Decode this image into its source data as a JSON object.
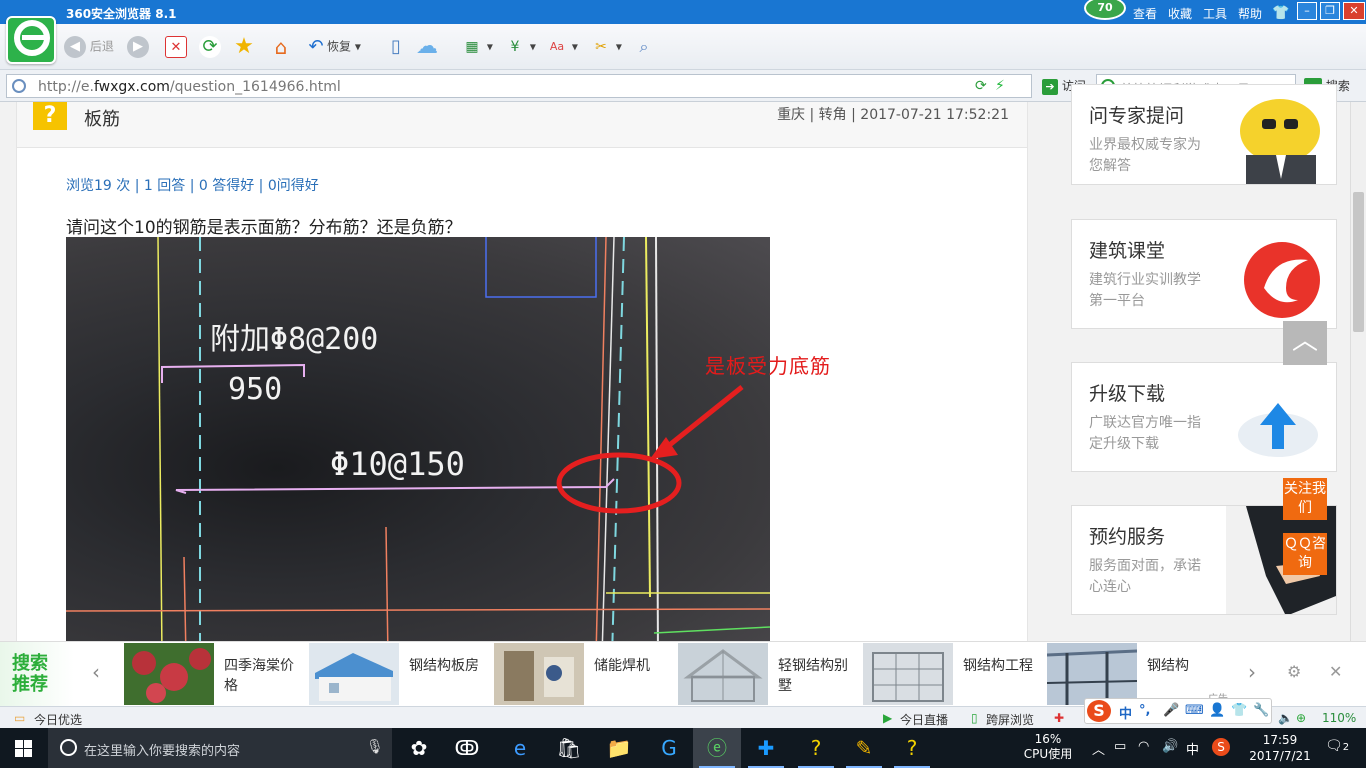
{
  "browser": {
    "title": "360安全浏览器 8.1",
    "score": "70",
    "menus": [
      "查看",
      "收藏",
      "工具",
      "帮助"
    ],
    "toolbar": {
      "back": "后退",
      "restore": "恢复"
    },
    "url_prefix": "http://e.",
    "url_domain": "fwxgx.com",
    "url_path": "/question_1614966.html",
    "visit_label": "访问",
    "search_placeholder": "羞答答福利游戏内可见",
    "search_label": "搜索"
  },
  "question": {
    "title": "板筋",
    "meta": "重庆 | 转角 | 2017-07-21 17:52:21",
    "stats": "浏览19 次 | 1 回答 | 0 答得好 | 0问得好",
    "text": "请问这个10的钢筋是表示面筋？分布筋？还是负筋？",
    "annotation": "是板受力底筋",
    "photo_labels": [
      "附加Φ8@200",
      "950",
      "Φ10@150"
    ]
  },
  "sidebar": [
    {
      "title": "问专家提问",
      "desc": "业界最权威专家为您解答"
    },
    {
      "title": "建筑课堂",
      "desc": "建筑行业实训教学第一平台"
    },
    {
      "title": "升级下载",
      "desc": "广联达官方唯一指定升级下载"
    },
    {
      "title": "预约服务",
      "desc": "服务面对面，承诺心连心"
    }
  ],
  "float": {
    "back_to_top": "︿",
    "follow": "关注我们",
    "qq": "ＱＱ咨询"
  },
  "recommend": {
    "label": "搜索推荐",
    "items": [
      {
        "text": "四季海棠价格",
        "color": "#b8323a"
      },
      {
        "text": "钢结构板房",
        "color": "#4b8fcf"
      },
      {
        "text": "储能焊机",
        "color": "#8a7a60"
      },
      {
        "text": "轻钢结构别墅",
        "color": "#9aa1a6"
      },
      {
        "text": "钢结构工程",
        "color": "#7d858c"
      },
      {
        "text": "钢结构",
        "color": "#5a6e86"
      }
    ],
    "ad_tag": "广告"
  },
  "statusbar": {
    "today": "今日优选",
    "live": "今日直播",
    "cross": "跨屏浏览",
    "zoom": "110%"
  },
  "ime": {
    "mode": "中"
  },
  "taskbar": {
    "search_placeholder": "在这里输入你要搜索的内容",
    "cpu_pct": "16%",
    "cpu_label": "CPU使用",
    "lang": "中",
    "time": "17:59",
    "date": "2017/7/21",
    "notif_count": "2"
  }
}
